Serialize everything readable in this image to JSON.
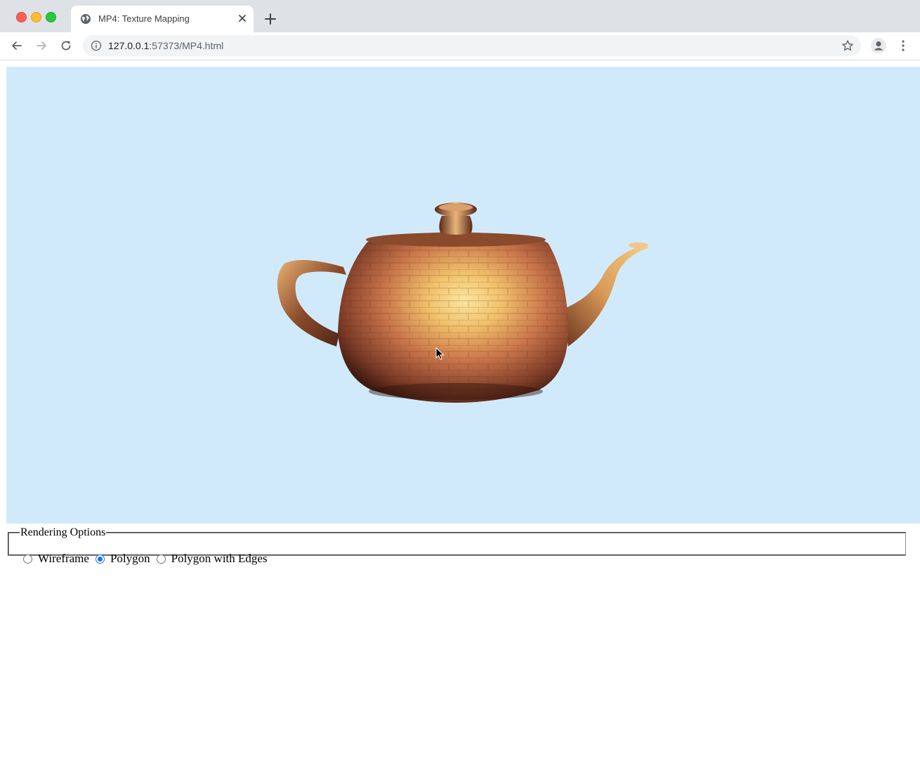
{
  "browser": {
    "tab_title": "MP4: Texture Mapping",
    "url_host": "127.0.0.1",
    "url_rest": ":57373/MP4.html",
    "icons": {
      "favicon": "globe-icon",
      "tab_close": "close-icon",
      "new_tab": "plus-icon",
      "back": "back-arrow-icon",
      "forward": "forward-arrow-icon",
      "reload": "reload-icon",
      "site_info": "info-icon",
      "bookmark": "star-icon",
      "profile": "person-icon",
      "menu": "kebab-menu-icon"
    }
  },
  "page": {
    "canvas_background": "#d0eafb",
    "rendering_options": {
      "legend": "Rendering Options",
      "options": [
        {
          "label": "Wireframe",
          "checked": false
        },
        {
          "label": "Polygon",
          "checked": true
        },
        {
          "label": "Polygon with Edges",
          "checked": false
        }
      ]
    }
  }
}
